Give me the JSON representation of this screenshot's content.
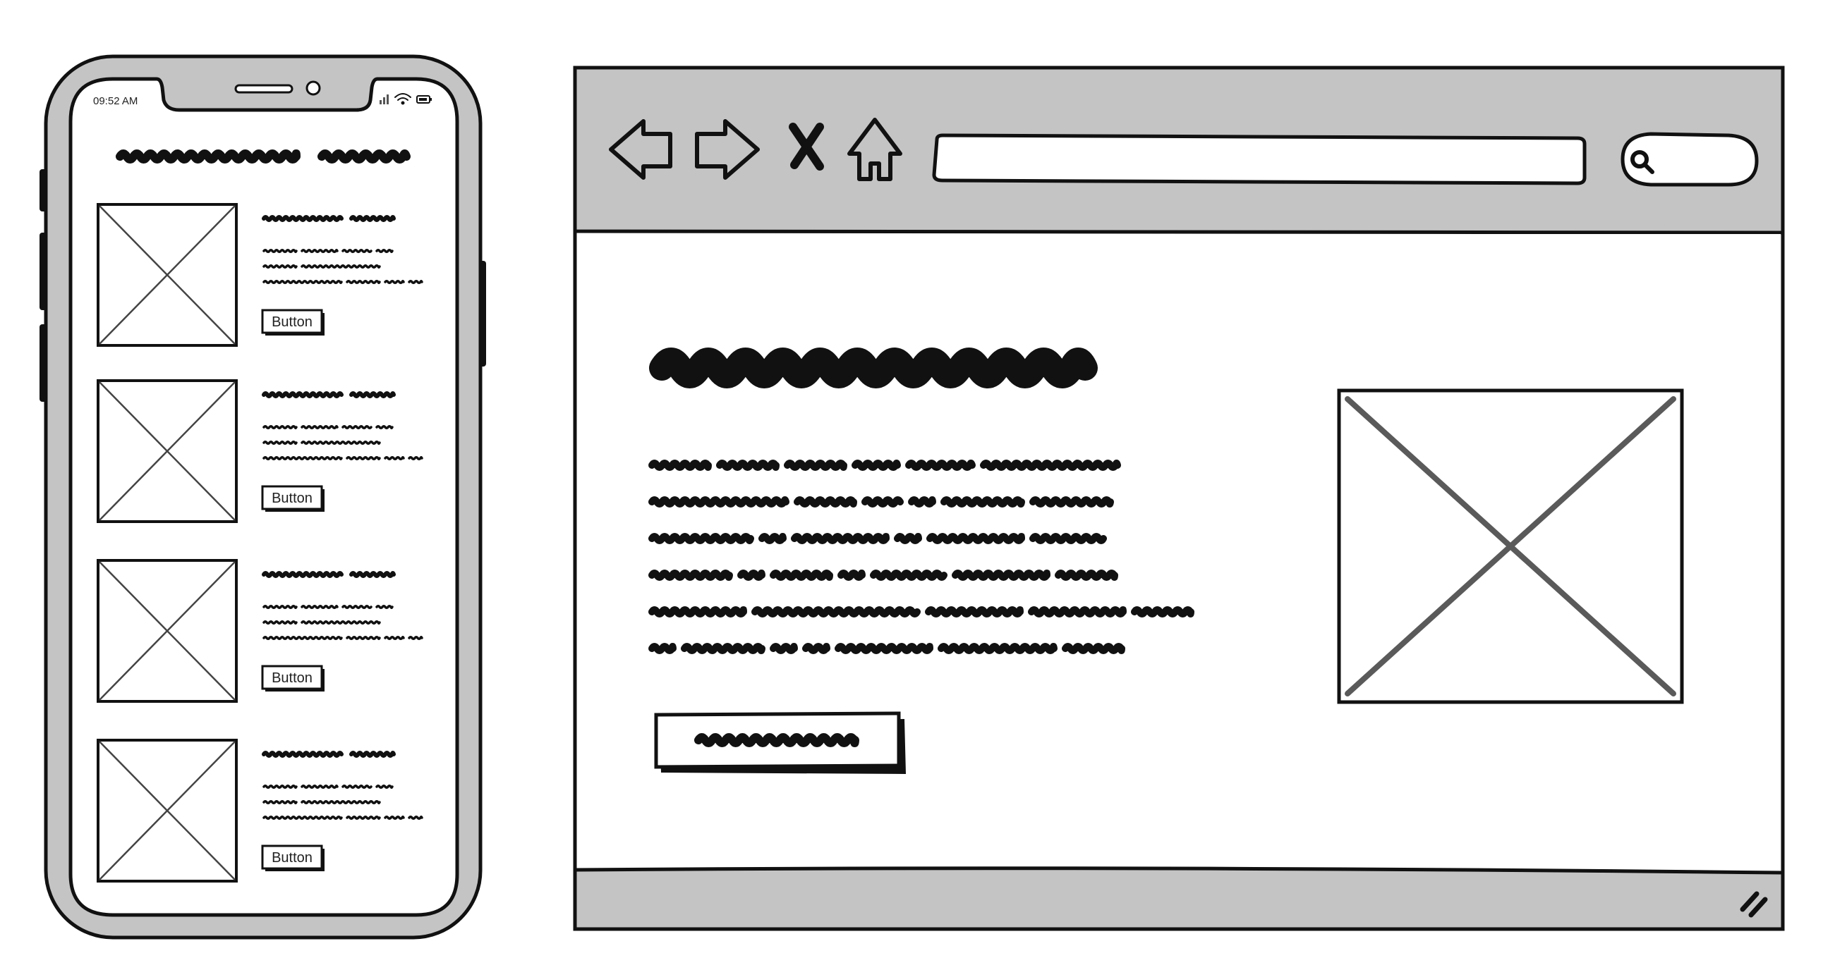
{
  "phone": {
    "status_time": "09:52 AM",
    "cards": [
      {
        "button_label": "Button"
      },
      {
        "button_label": "Button"
      },
      {
        "button_label": "Button"
      },
      {
        "button_label": "Button"
      }
    ]
  },
  "browser": {
    "address_value": "",
    "search_value": ""
  },
  "colors": {
    "frame_gray": "#c4c4c4",
    "ink": "#111111",
    "background": "#ffffff",
    "placeholder_cross": "#5a5a5a"
  },
  "icons": [
    "back-arrow-icon",
    "forward-arrow-icon",
    "close-icon",
    "home-icon",
    "search-icon",
    "resize-grip-icon",
    "signal-icon",
    "wifi-icon",
    "battery-icon"
  ]
}
